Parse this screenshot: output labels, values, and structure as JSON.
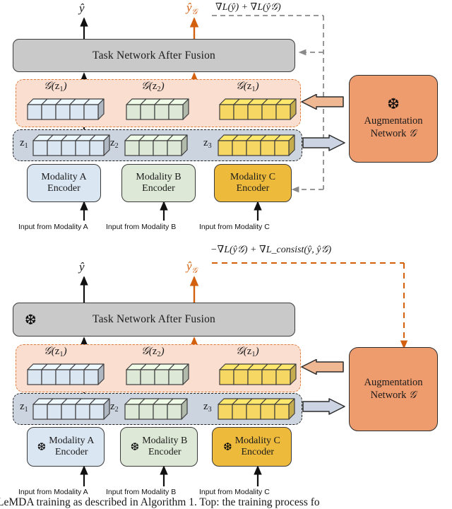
{
  "figure": {
    "title": "LeMDA training diagram",
    "caption": "LeMDA training as described in Algorithm 1.  Top:  the training process fo"
  },
  "colors": {
    "task_network_fill": "#c9c9c9",
    "augmentation_fill": "#ee9b6e",
    "g_region_fill": "#fadfd1",
    "g_region_border": "#e07b39",
    "z_region_fill": "#ccd4e0",
    "z_region_border": "#222222",
    "modality_a": "#dbe6f3",
    "modality_b": "#dde9d6",
    "modality_c": "#edba3b",
    "orange_arrow": "#d2600f",
    "black_arrow": "#111111",
    "gray_dashed": "#8a8a8a"
  },
  "top_panel": {
    "output_plain": {
      "label": "ŷ",
      "name": "y-hat"
    },
    "output_aug": {
      "label": "ŷ",
      "sub": "𝒢",
      "name": "y-hat-g"
    },
    "gradient_formula": "∇L(ŷ) + ∇L(ŷ𝒢)",
    "task_network": {
      "label": "Task Network After Fusion",
      "frozen": false
    },
    "g_region": {
      "items": [
        {
          "label_g": "𝒢",
          "label_z": "z",
          "sub": "1",
          "cubes": 5,
          "color": "#dbe6f3"
        },
        {
          "label_g": "𝒢",
          "label_z": "z",
          "sub": "2",
          "cubes": 4,
          "color": "#dde9d6"
        },
        {
          "label_g": "𝒢",
          "label_z": "z",
          "sub": "1",
          "cubes": 5,
          "color": "#f6d763"
        }
      ]
    },
    "z_region": {
      "items": [
        {
          "label": "z",
          "sub": "1",
          "cubes": 5,
          "color": "#dbe6f3"
        },
        {
          "label": "z",
          "sub": "2",
          "cubes": 4,
          "color": "#dde9d6"
        },
        {
          "label": "z",
          "sub": "3",
          "cubes": 5,
          "color": "#f6d763"
        }
      ]
    },
    "encoders": [
      {
        "line1": "Modality A",
        "line2": "Encoder",
        "frozen": false,
        "input": "Input  from Modality A"
      },
      {
        "line1": "Modality B",
        "line2": "Encoder",
        "frozen": false,
        "input": "Input from Modality B"
      },
      {
        "line1": "Modality C",
        "line2": "Encoder",
        "frozen": false,
        "input": "Input from Modality C"
      }
    ],
    "augmentation": {
      "line1": "Augmentation",
      "line2": "Network",
      "symbol": "𝒢",
      "frozen": true
    }
  },
  "bottom_panel": {
    "output_plain": {
      "label": "ŷ",
      "name": "y-hat"
    },
    "output_aug": {
      "label": "ŷ",
      "sub": "𝒢",
      "name": "y-hat-g"
    },
    "gradient_formula": "−∇L(ŷ𝒢) + ∇L_consist(ŷ, ŷ𝒢)",
    "task_network": {
      "label": "Task Network After Fusion",
      "frozen": true
    },
    "g_region": {
      "items": [
        {
          "label_g": "𝒢",
          "label_z": "z",
          "sub": "1",
          "cubes": 5,
          "color": "#dbe6f3"
        },
        {
          "label_g": "𝒢",
          "label_z": "z",
          "sub": "2",
          "cubes": 4,
          "color": "#dde9d6"
        },
        {
          "label_g": "𝒢",
          "label_z": "z",
          "sub": "1",
          "cubes": 5,
          "color": "#f6d763"
        }
      ]
    },
    "z_region": {
      "items": [
        {
          "label": "z",
          "sub": "1",
          "cubes": 5,
          "color": "#dbe6f3"
        },
        {
          "label": "z",
          "sub": "2",
          "cubes": 4,
          "color": "#dde9d6"
        },
        {
          "label": "z",
          "sub": "3",
          "cubes": 5,
          "color": "#f6d763"
        }
      ]
    },
    "encoders": [
      {
        "line1": "Modality A",
        "line2": "Encoder",
        "frozen": true,
        "input": "Input  from Modality A"
      },
      {
        "line1": "Modality B",
        "line2": "Encoder",
        "frozen": true,
        "input": "Input from Modality B"
      },
      {
        "line1": "Modality C",
        "line2": "Encoder",
        "frozen": true,
        "input": "Input from Modality C"
      }
    ],
    "augmentation": {
      "line1": "Augmentation",
      "line2": "Network",
      "symbol": "𝒢",
      "frozen": false
    }
  },
  "icons": {
    "snowflake": "❆"
  }
}
